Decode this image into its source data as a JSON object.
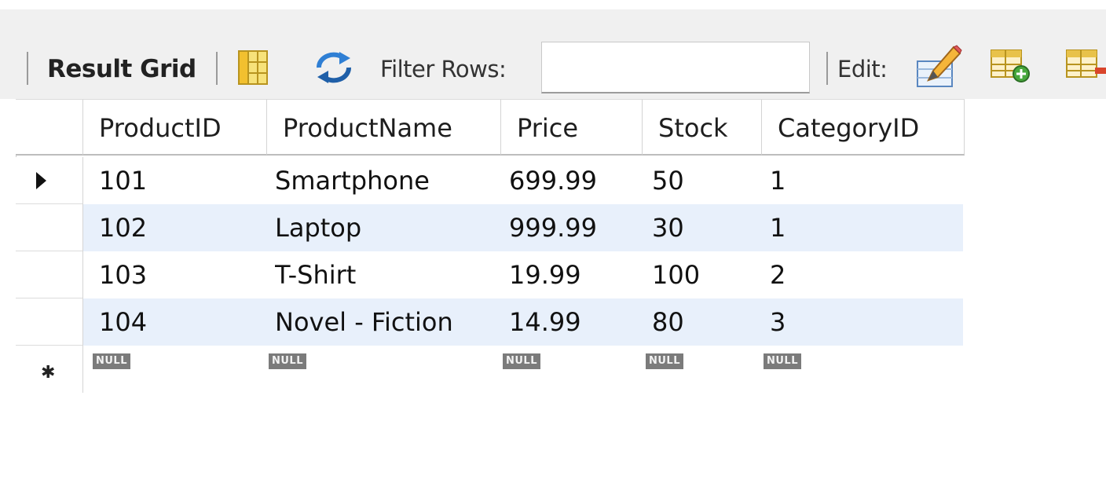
{
  "toolbar": {
    "result_grid_label": "Result Grid",
    "filter_label": "Filter Rows:",
    "filter_value": "",
    "edit_label": "Edit:"
  },
  "grid": {
    "columns": [
      "ProductID",
      "ProductName",
      "Price",
      "Stock",
      "CategoryID"
    ],
    "rows": [
      [
        "101",
        "Smartphone",
        "699.99",
        "50",
        "1"
      ],
      [
        "102",
        "Laptop",
        "999.99",
        "30",
        "1"
      ],
      [
        "103",
        "T-Shirt",
        "19.99",
        "100",
        "2"
      ],
      [
        "104",
        "Novel - Fiction",
        "14.99",
        "80",
        "3"
      ]
    ],
    "new_row_placeholder": "NULL",
    "current_row_indicator": "▶",
    "new_row_indicator": "*",
    "alt_row_color": "#e8f0fb"
  }
}
